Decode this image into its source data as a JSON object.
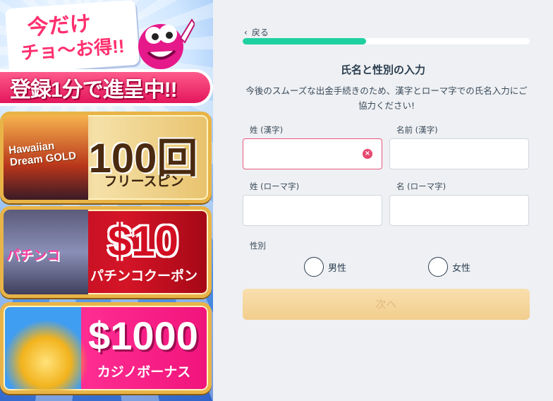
{
  "promo": {
    "headline_line1": "今だけ",
    "headline_line2": "チョ〜お得!!",
    "tagline": "登録1分で進呈中!!",
    "offers": [
      {
        "game_logo": "Hawaiian Dream GOLD",
        "amount": "100回",
        "caption": "フリースピン"
      },
      {
        "game_logo": "パチンコ",
        "amount": "$10",
        "caption": "パチンコクーポン"
      },
      {
        "amount": "$1000",
        "caption": "カジノボーナス"
      }
    ]
  },
  "form": {
    "back_label": "戻る",
    "progress": 0.43,
    "title": "氏名と性別の入力",
    "description": "今後のスムーズな出金手続きのため、漢字とローマ字での氏名入力にご協力ください!",
    "fields": {
      "last_kanji_label": "姓 (漢字)",
      "first_kanji_label": "名前 (漢字)",
      "last_roman_label": "姓 (ローマ字)",
      "first_roman_label": "名 (ローマ字)"
    },
    "gender_label": "性別",
    "gender_options": [
      "男性",
      "女性"
    ],
    "next_label": "次へ"
  },
  "colors": {
    "progress_fill": "#1fd0a0",
    "error_border": "#e8587c",
    "next_button": "#f2ce8d"
  }
}
